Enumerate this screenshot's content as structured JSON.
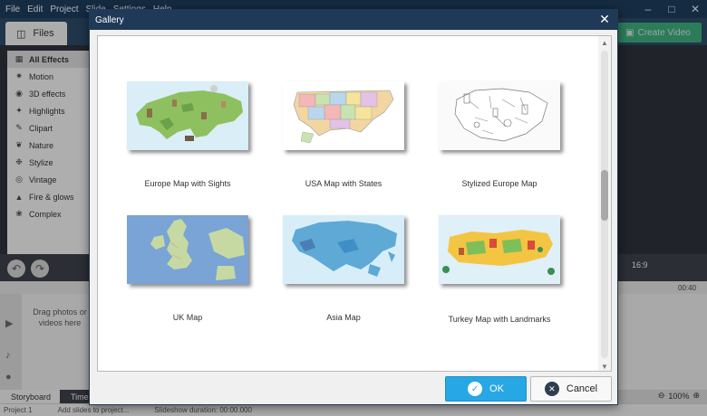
{
  "menu": [
    "File",
    "Edit",
    "Project",
    "Slide",
    "Settings",
    "Help"
  ],
  "topbar": {
    "files_tab": "Files",
    "create_video": "Create Video"
  },
  "sidebar": {
    "items": [
      {
        "label": "All Effects",
        "icon": "grid-icon"
      },
      {
        "label": "Motion",
        "icon": "motion-icon"
      },
      {
        "label": "3D effects",
        "icon": "cube-icon"
      },
      {
        "label": "Highlights",
        "icon": "sparkle-icon"
      },
      {
        "label": "Clipart",
        "icon": "clipart-icon"
      },
      {
        "label": "Nature",
        "icon": "leaf-icon"
      },
      {
        "label": "Stylize",
        "icon": "stylize-icon"
      },
      {
        "label": "Vintage",
        "icon": "vintage-icon"
      },
      {
        "label": "Fire & glows",
        "icon": "fire-icon"
      },
      {
        "label": "Complex",
        "icon": "complex-icon"
      }
    ]
  },
  "timeline": {
    "drag_hint": "Drag photos or videos here",
    "timecode_right": "00:40",
    "aspect": "16:9"
  },
  "bottom_tabs": {
    "storyboard": "Storyboard",
    "timeline": "Timel"
  },
  "zoom": "100%",
  "status": {
    "project": "Project 1",
    "hint": "Add slides to project...",
    "duration": "Slideshow duration: 00:00.000"
  },
  "dialog": {
    "title": "Gallery",
    "ok_label": "OK",
    "cancel_label": "Cancel",
    "items": [
      {
        "label": "Europe Map with Sights"
      },
      {
        "label": "USA Map with States"
      },
      {
        "label": "Stylized Europe Map"
      },
      {
        "label": "UK Map"
      },
      {
        "label": "Asia Map"
      },
      {
        "label": "Turkey Map with Landmarks"
      }
    ]
  },
  "colors": {
    "title_bar": "#1f3a57",
    "ok_button": "#27a8e4",
    "create_video": "#3fb77d"
  }
}
